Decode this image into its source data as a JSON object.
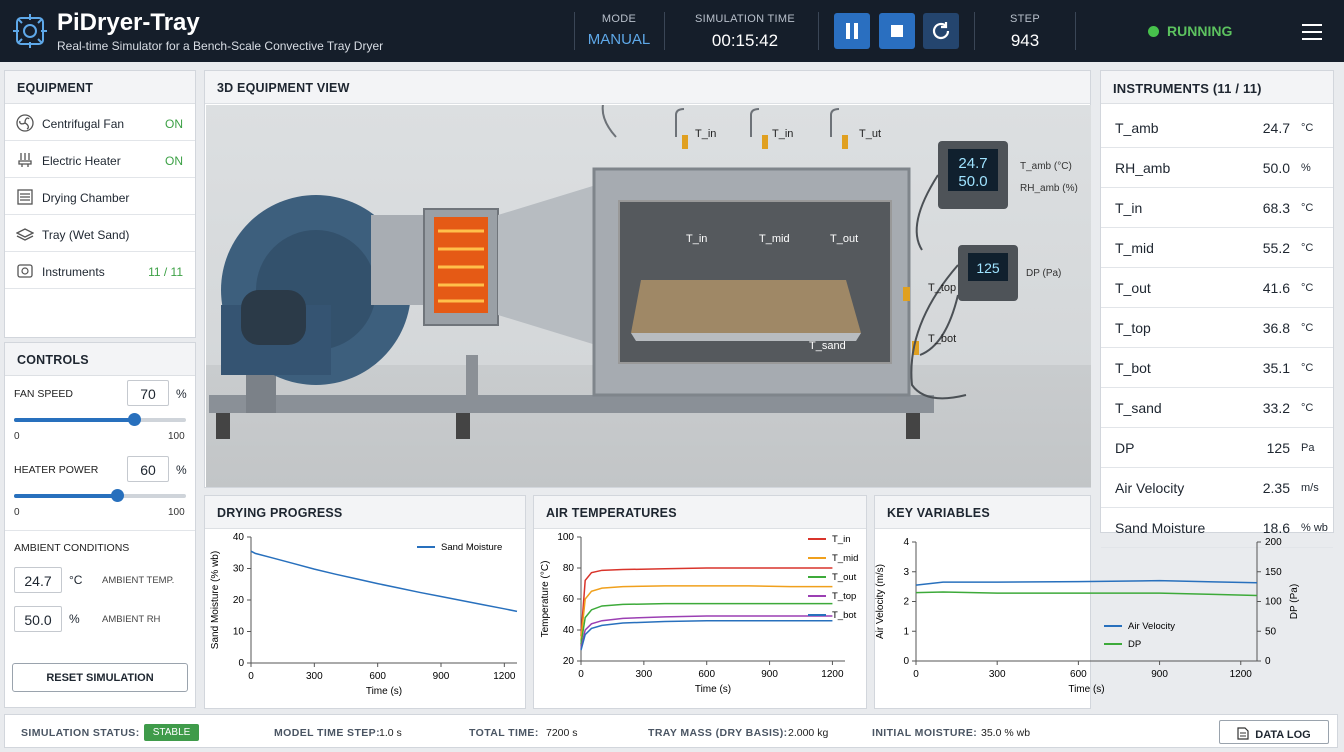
{
  "header": {
    "title": "PiDryer-Tray",
    "subtitle": "Real-time Simulator for a Bench-Scale Convective Tray Dryer",
    "mode_label": "MODE",
    "mode_value": "MANUAL",
    "time_label": "SIMULATION TIME",
    "time_value": "00:15:42",
    "step_label": "STEP",
    "step_value": "943",
    "status": "RUNNING"
  },
  "colors": {
    "accent": "#2870bd",
    "running": "#47c24c",
    "on": "#3da146",
    "header_bg": "#151e2a"
  },
  "equipment": {
    "title": "EQUIPMENT",
    "items": [
      {
        "icon": "fan-icon",
        "label": "Centrifugal Fan",
        "status": "ON"
      },
      {
        "icon": "heater-icon",
        "label": "Electric Heater",
        "status": "ON"
      },
      {
        "icon": "chamber-icon",
        "label": "Drying Chamber",
        "status": ""
      },
      {
        "icon": "tray-icon",
        "label": "Tray (Wet Sand)",
        "status": ""
      },
      {
        "icon": "instruments-icon",
        "label": "Instruments",
        "status": "11 / 11"
      }
    ]
  },
  "controls": {
    "title": "CONTROLS",
    "fan_label": "FAN SPEED",
    "fan_value": "70",
    "fan_unit": "%",
    "fan_fraction": 0.7,
    "fan_min": "0",
    "fan_max": "100",
    "heater_label": "HEATER POWER",
    "heater_value": "60",
    "heater_unit": "%",
    "heater_fraction": 0.6,
    "heater_min": "0",
    "heater_max": "100",
    "ambient_title": "AMBIENT CONDITIONS",
    "amb_temp_value": "24.7",
    "amb_temp_unit": "°C",
    "amb_temp_label": "AMBIENT TEMP.",
    "amb_rh_value": "50.0",
    "amb_rh_unit": "%",
    "amb_rh_label": "AMBIENT RH",
    "reset_label": "RESET SIMULATION"
  },
  "view": {
    "title": "3D EQUIPMENT VIEW",
    "display1_top": "24.7",
    "display1_bottom": "50.0",
    "display1_label1": "T_amb (°C)",
    "display1_label2": "RH_amb (%)",
    "display2_value": "125",
    "display2_label": "DP (Pa)"
  },
  "instruments": {
    "title": "INSTRUMENTS (11 / 11)",
    "rows": [
      {
        "name": "T_amb",
        "value": "24.7",
        "unit": "°C"
      },
      {
        "name": "RH_amb",
        "value": "50.0",
        "unit": "%"
      },
      {
        "name": "T_in",
        "value": "68.3",
        "unit": "°C"
      },
      {
        "name": "T_mid",
        "value": "55.2",
        "unit": "°C"
      },
      {
        "name": "T_out",
        "value": "41.6",
        "unit": "°C"
      },
      {
        "name": "T_top",
        "value": "36.8",
        "unit": "°C"
      },
      {
        "name": "T_bot",
        "value": "35.1",
        "unit": "°C"
      },
      {
        "name": "T_sand",
        "value": "33.2",
        "unit": "°C"
      },
      {
        "name": "DP",
        "value": "125",
        "unit": "Pa"
      },
      {
        "name": "Air Velocity",
        "value": "2.35",
        "unit": "m/s"
      },
      {
        "name": "Sand Moisture",
        "value": "18.6",
        "unit": "% wb"
      }
    ]
  },
  "chart_data": [
    {
      "type": "line",
      "title": "DRYING PROGRESS",
      "xlabel": "Time (s)",
      "ylabel": "Sand Moisture (% wb)",
      "xlim": [
        0,
        1260
      ],
      "ylim": [
        0,
        40
      ],
      "xticks": [
        0,
        300,
        600,
        900,
        1200
      ],
      "yticks": [
        0,
        10,
        20,
        30,
        40
      ],
      "legend": "top-right",
      "series": [
        {
          "name": "Sand Moisture",
          "color": "#2870bd",
          "x": [
            0,
            20,
            100,
            200,
            300,
            400,
            500,
            600,
            700,
            800,
            900,
            1000,
            1100,
            1200,
            1260
          ],
          "y": [
            35.5,
            34.8,
            33.4,
            31.6,
            29.8,
            28.2,
            26.7,
            25.2,
            23.8,
            22.4,
            21.1,
            19.8,
            18.5,
            17.2,
            16.4
          ]
        }
      ]
    },
    {
      "type": "line",
      "title": "AIR TEMPERATURES",
      "xlabel": "Time (s)",
      "ylabel": "Temperature (°C)",
      "xlim": [
        0,
        1260
      ],
      "ylim": [
        20,
        100
      ],
      "xticks": [
        0,
        300,
        600,
        900,
        1200
      ],
      "yticks": [
        20,
        40,
        60,
        80,
        100
      ],
      "legend": "right",
      "series": [
        {
          "name": "T_in",
          "color": "#d9342b",
          "x": [
            0,
            20,
            50,
            100,
            200,
            400,
            600,
            800,
            1000,
            1200
          ],
          "y": [
            36,
            72,
            77,
            78.5,
            79,
            79.5,
            80,
            80,
            80,
            80
          ]
        },
        {
          "name": "T_mid",
          "color": "#f0a01c",
          "x": [
            0,
            20,
            50,
            100,
            200,
            400,
            600,
            800,
            1000,
            1200
          ],
          "y": [
            34,
            60,
            65,
            67,
            68,
            68.5,
            68.5,
            68.5,
            68,
            68
          ]
        },
        {
          "name": "T_out",
          "color": "#3daa3a",
          "x": [
            0,
            20,
            50,
            100,
            200,
            400,
            600,
            800,
            1000,
            1200
          ],
          "y": [
            31,
            48,
            53,
            55.5,
            56.5,
            57,
            57,
            57,
            57,
            57
          ]
        },
        {
          "name": "T_top",
          "color": "#9b3fb3",
          "x": [
            0,
            20,
            50,
            100,
            200,
            400,
            600,
            800,
            1000,
            1200
          ],
          "y": [
            28,
            40,
            44,
            46,
            47.5,
            48.5,
            49,
            49,
            49,
            49
          ]
        },
        {
          "name": "T_bot",
          "color": "#2870bd",
          "x": [
            0,
            20,
            50,
            100,
            200,
            400,
            600,
            800,
            1000,
            1200
          ],
          "y": [
            27,
            37,
            41,
            43,
            44.5,
            45.5,
            46,
            46,
            46,
            46
          ]
        }
      ]
    },
    {
      "type": "line",
      "title": "KEY VARIABLES",
      "xlabel": "Time (s)",
      "ylabel": "Air Velocity (m/s)",
      "y2label": "DP (Pa)",
      "xlim": [
        0,
        1260
      ],
      "ylim": [
        0,
        4
      ],
      "y2lim": [
        0,
        200
      ],
      "xticks": [
        0,
        300,
        600,
        900,
        1200
      ],
      "yticks": [
        0,
        1,
        2,
        3,
        4
      ],
      "y2ticks": [
        0,
        50,
        100,
        150,
        200
      ],
      "legend": "bottom-center",
      "series": [
        {
          "name": "Air Velocity",
          "color": "#2870bd",
          "axis": "left",
          "x": [
            0,
            100,
            300,
            600,
            900,
            1100,
            1260
          ],
          "y": [
            2.55,
            2.65,
            2.65,
            2.67,
            2.7,
            2.66,
            2.63
          ]
        },
        {
          "name": "DP",
          "color": "#3daa3a",
          "axis": "right",
          "x": [
            0,
            100,
            300,
            600,
            900,
            1100,
            1260
          ],
          "y": [
            115,
            116,
            114,
            114,
            114,
            112,
            110
          ]
        }
      ]
    }
  ],
  "footer": {
    "status_label": "SIMULATION STATUS:",
    "status_value": "STABLE",
    "step_label": "MODEL TIME STEP:",
    "step_value": "1.0 s",
    "total_label": "TOTAL TIME:",
    "total_value": "7200 s",
    "mass_label": "TRAY MASS (DRY BASIS):",
    "mass_value": "2.000 kg",
    "moist_label": "INITIAL MOISTURE:",
    "moist_value": "35.0 % wb",
    "datalog_label": "DATA LOG"
  }
}
